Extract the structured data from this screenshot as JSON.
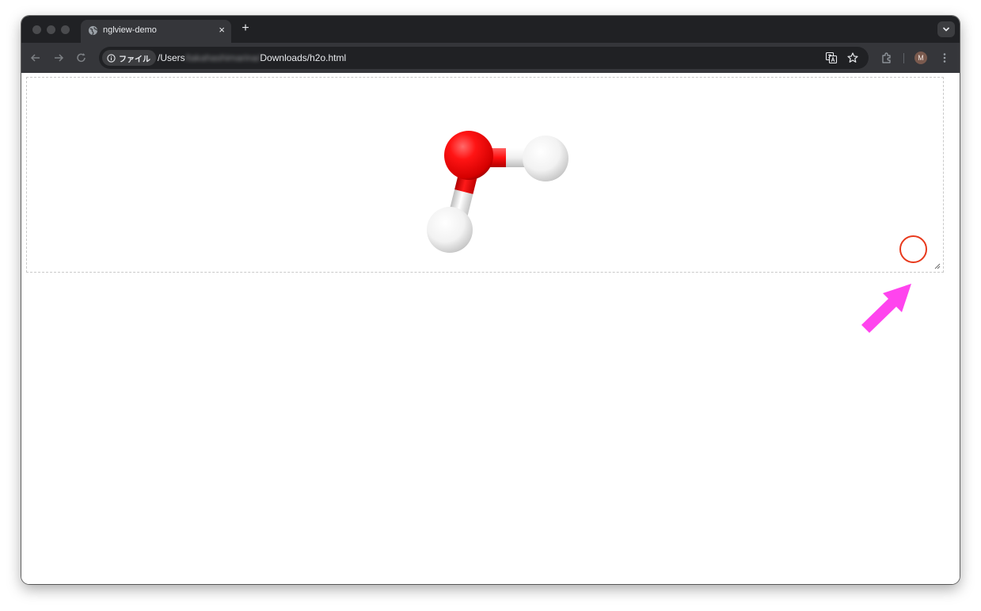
{
  "browser": {
    "tab": {
      "title": "nglview-demo",
      "favicon": "globe-icon",
      "close": "×"
    },
    "new_tab": "+",
    "omnibox": {
      "chip_icon": "info-icon",
      "chip_label": "ファイル",
      "url_prefix": "/Users",
      "url_redacted": "/takahashimarina/",
      "url_suffix": "Downloads/h2o.html"
    },
    "profile_initial": "M"
  },
  "viewer": {
    "molecule": "H2O",
    "atoms": [
      {
        "element": "O",
        "color": "#ff0d0d"
      },
      {
        "element": "H",
        "color": "#ffffff"
      },
      {
        "element": "H",
        "color": "#ffffff"
      }
    ],
    "resize_handle": "resize-grip-icon"
  },
  "annotations": {
    "highlight_color": "#e8391c",
    "arrow_color": "#ff44ee"
  }
}
